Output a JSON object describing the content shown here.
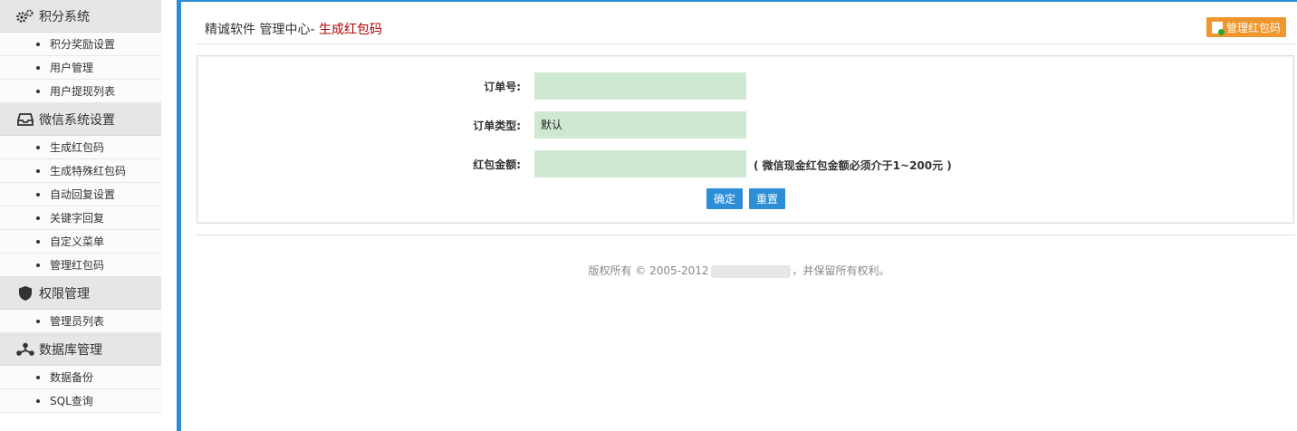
{
  "sidebar": {
    "sections": [
      {
        "title": "积分系统",
        "icon": "gears-icon",
        "items": [
          "积分奖励设置",
          "用户管理",
          "用户提现列表"
        ]
      },
      {
        "title": "微信系统设置",
        "icon": "inbox-icon",
        "items": [
          "生成红包码",
          "生成特殊红包码",
          "自动回复设置",
          "关键字回复",
          "自定义菜单",
          "管理红包码"
        ]
      },
      {
        "title": "权限管理",
        "icon": "shield-icon",
        "items": [
          "管理员列表"
        ]
      },
      {
        "title": "数据库管理",
        "icon": "network-icon",
        "items": [
          "数据备份",
          "SQL查询"
        ]
      }
    ]
  },
  "header": {
    "breadcrumb_prefix": "精诚软件 管理中心-",
    "breadcrumb_current": " 生成红包码",
    "manage_button": "管理红包码"
  },
  "form": {
    "order_no_label": "订单号:",
    "order_no_value": "",
    "order_type_label": "订单类型:",
    "order_type_value": "默认",
    "amount_label": "红包金额:",
    "amount_value": "",
    "amount_hint": "( 微信现金红包金额必须介于1~200元 )",
    "confirm_label": "确定",
    "reset_label": "重置"
  },
  "footer": {
    "copyright_prefix": "版权所有 © 2005-2012",
    "copyright_suffix": "，并保留所有权利。"
  },
  "colors": {
    "accent_blue": "#2b8ed6",
    "orange": "#f0962e",
    "input_bg": "#cfe8d1",
    "breadcrumb_red": "#b20000"
  }
}
